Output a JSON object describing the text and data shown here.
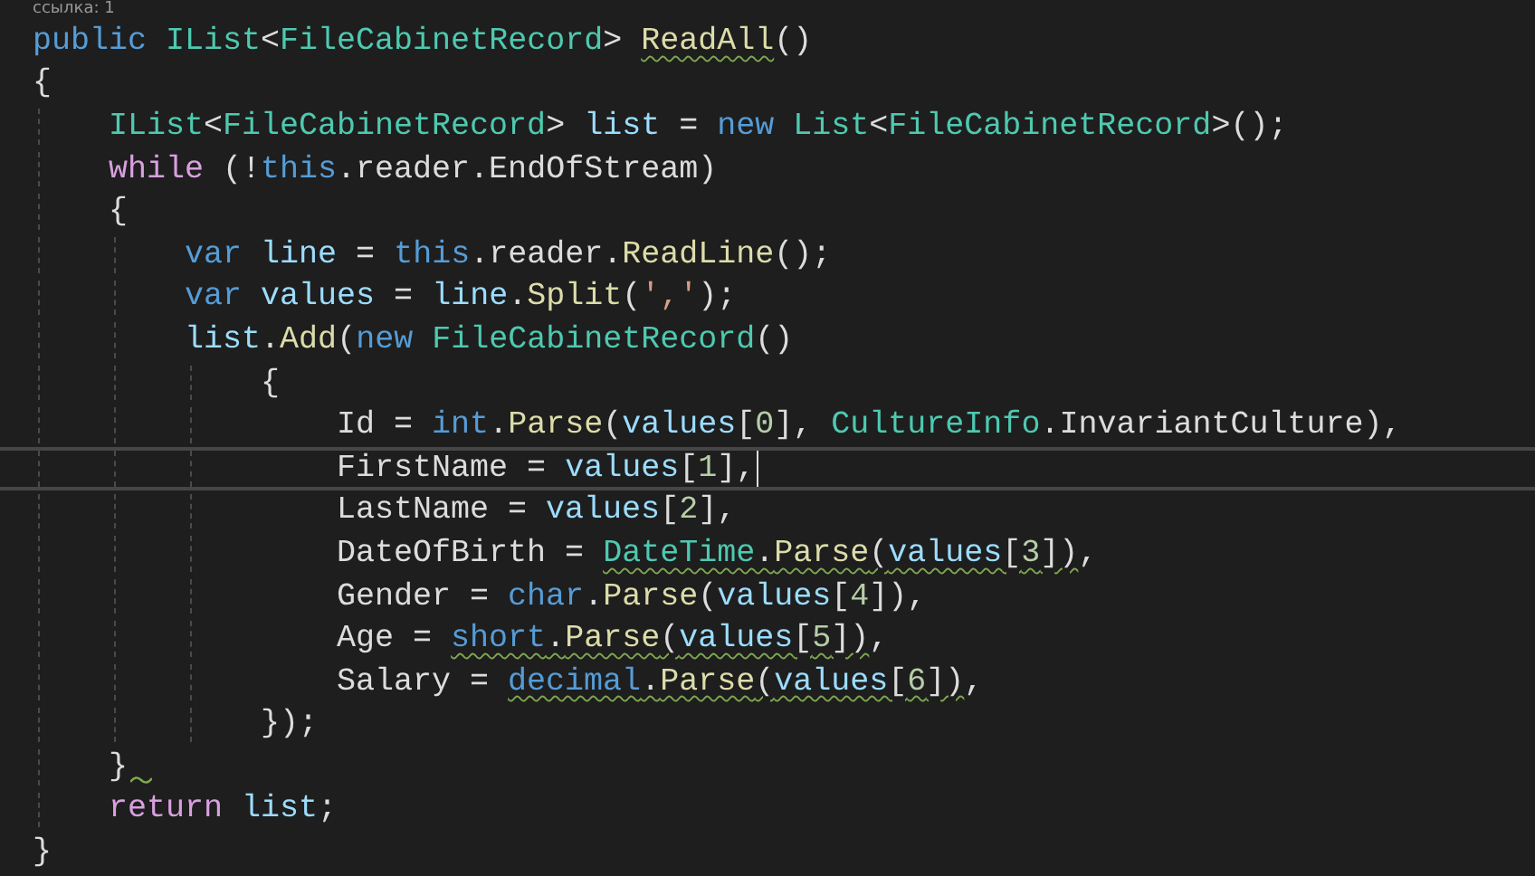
{
  "codelens": "ссылка: 1",
  "lines": [
    {
      "current": false,
      "tokens": [
        {
          "kind": "keyword",
          "text": "public "
        },
        {
          "kind": "type",
          "text": "IList"
        },
        {
          "kind": "plain",
          "text": "<"
        },
        {
          "kind": "type",
          "text": "FileCabinetRecord"
        },
        {
          "kind": "plain",
          "text": "> "
        },
        {
          "kind": "method",
          "text": "ReadAll",
          "squiggle": true
        },
        {
          "kind": "plain",
          "text": "()"
        }
      ]
    },
    {
      "current": false,
      "tokens": [
        {
          "kind": "plain",
          "text": "{"
        }
      ]
    },
    {
      "current": false,
      "tokens": [
        {
          "kind": "type",
          "text": "    IList"
        },
        {
          "kind": "plain",
          "text": "<"
        },
        {
          "kind": "type",
          "text": "FileCabinetRecord"
        },
        {
          "kind": "plain",
          "text": "> "
        },
        {
          "kind": "variable",
          "text": "list"
        },
        {
          "kind": "plain",
          "text": " = "
        },
        {
          "kind": "keyword",
          "text": "new "
        },
        {
          "kind": "type",
          "text": "List"
        },
        {
          "kind": "plain",
          "text": "<"
        },
        {
          "kind": "type",
          "text": "FileCabinetRecord"
        },
        {
          "kind": "plain",
          "text": ">();"
        }
      ]
    },
    {
      "current": false,
      "tokens": [
        {
          "kind": "control",
          "text": "    while"
        },
        {
          "kind": "plain",
          "text": " (!"
        },
        {
          "kind": "keyword",
          "text": "this"
        },
        {
          "kind": "plain",
          "text": ".reader.EndOfStream)"
        }
      ]
    },
    {
      "current": false,
      "tokens": [
        {
          "kind": "plain",
          "text": "    {"
        }
      ]
    },
    {
      "current": false,
      "tokens": [
        {
          "kind": "keyword",
          "text": "        var "
        },
        {
          "kind": "variable",
          "text": "line"
        },
        {
          "kind": "plain",
          "text": " = "
        },
        {
          "kind": "keyword",
          "text": "this"
        },
        {
          "kind": "plain",
          "text": ".reader."
        },
        {
          "kind": "method",
          "text": "ReadLine"
        },
        {
          "kind": "plain",
          "text": "();"
        }
      ]
    },
    {
      "current": false,
      "tokens": [
        {
          "kind": "keyword",
          "text": "        var "
        },
        {
          "kind": "variable",
          "text": "values"
        },
        {
          "kind": "plain",
          "text": " = "
        },
        {
          "kind": "variable",
          "text": "line"
        },
        {
          "kind": "plain",
          "text": "."
        },
        {
          "kind": "method",
          "text": "Split"
        },
        {
          "kind": "plain",
          "text": "("
        },
        {
          "kind": "string",
          "text": "','"
        },
        {
          "kind": "plain",
          "text": ");"
        }
      ]
    },
    {
      "current": false,
      "tokens": [
        {
          "kind": "variable",
          "text": "        list"
        },
        {
          "kind": "plain",
          "text": "."
        },
        {
          "kind": "method",
          "text": "Add"
        },
        {
          "kind": "plain",
          "text": "("
        },
        {
          "kind": "keyword",
          "text": "new "
        },
        {
          "kind": "type",
          "text": "FileCabinetRecord"
        },
        {
          "kind": "plain",
          "text": "()"
        }
      ]
    },
    {
      "current": false,
      "tokens": [
        {
          "kind": "plain",
          "text": "            {"
        }
      ]
    },
    {
      "current": false,
      "tokens": [
        {
          "kind": "plain",
          "text": "                Id = "
        },
        {
          "kind": "keyword",
          "text": "int"
        },
        {
          "kind": "plain",
          "text": "."
        },
        {
          "kind": "method",
          "text": "Parse"
        },
        {
          "kind": "plain",
          "text": "("
        },
        {
          "kind": "variable",
          "text": "values"
        },
        {
          "kind": "plain",
          "text": "["
        },
        {
          "kind": "number",
          "text": "0"
        },
        {
          "kind": "plain",
          "text": "], "
        },
        {
          "kind": "type",
          "text": "CultureInfo"
        },
        {
          "kind": "plain",
          "text": ".InvariantCulture),"
        }
      ]
    },
    {
      "current": true,
      "tokens": [
        {
          "kind": "plain",
          "text": "                FirstName = "
        },
        {
          "kind": "variable",
          "text": "values"
        },
        {
          "kind": "plain",
          "text": "["
        },
        {
          "kind": "number",
          "text": "1"
        },
        {
          "kind": "plain",
          "text": "],"
        }
      ]
    },
    {
      "current": false,
      "tokens": [
        {
          "kind": "plain",
          "text": "                LastName = "
        },
        {
          "kind": "variable",
          "text": "values"
        },
        {
          "kind": "plain",
          "text": "["
        },
        {
          "kind": "number",
          "text": "2"
        },
        {
          "kind": "plain",
          "text": "],"
        }
      ]
    },
    {
      "current": false,
      "tokens": [
        {
          "kind": "plain",
          "text": "                DateOfBirth = "
        },
        {
          "kind": "type",
          "text": "DateTime",
          "squiggle": true
        },
        {
          "kind": "plain",
          "text": ".",
          "squiggle": true
        },
        {
          "kind": "method",
          "text": "Parse",
          "squiggle": true
        },
        {
          "kind": "plain",
          "text": "(",
          "squiggle": true
        },
        {
          "kind": "variable",
          "text": "values",
          "squiggle": true
        },
        {
          "kind": "plain",
          "text": "[",
          "squiggle": true
        },
        {
          "kind": "number",
          "text": "3",
          "squiggle": true
        },
        {
          "kind": "plain",
          "text": "])",
          "squiggle": true
        },
        {
          "kind": "plain",
          "text": ","
        }
      ]
    },
    {
      "current": false,
      "tokens": [
        {
          "kind": "plain",
          "text": "                Gender = "
        },
        {
          "kind": "keyword",
          "text": "char"
        },
        {
          "kind": "plain",
          "text": "."
        },
        {
          "kind": "method",
          "text": "Parse"
        },
        {
          "kind": "plain",
          "text": "("
        },
        {
          "kind": "variable",
          "text": "values"
        },
        {
          "kind": "plain",
          "text": "["
        },
        {
          "kind": "number",
          "text": "4"
        },
        {
          "kind": "plain",
          "text": "]),"
        }
      ]
    },
    {
      "current": false,
      "tokens": [
        {
          "kind": "plain",
          "text": "                Age = "
        },
        {
          "kind": "keyword",
          "text": "short",
          "squiggle": true
        },
        {
          "kind": "plain",
          "text": ".",
          "squiggle": true
        },
        {
          "kind": "method",
          "text": "Parse",
          "squiggle": true
        },
        {
          "kind": "plain",
          "text": "(",
          "squiggle": true
        },
        {
          "kind": "variable",
          "text": "values",
          "squiggle": true
        },
        {
          "kind": "plain",
          "text": "[",
          "squiggle": true
        },
        {
          "kind": "number",
          "text": "5",
          "squiggle": true
        },
        {
          "kind": "plain",
          "text": "])",
          "squiggle": true
        },
        {
          "kind": "plain",
          "text": ","
        }
      ]
    },
    {
      "current": false,
      "tokens": [
        {
          "kind": "plain",
          "text": "                Salary = "
        },
        {
          "kind": "keyword",
          "text": "decimal",
          "squiggle": true
        },
        {
          "kind": "plain",
          "text": ".",
          "squiggle": true
        },
        {
          "kind": "method",
          "text": "Parse",
          "squiggle": true
        },
        {
          "kind": "plain",
          "text": "(",
          "squiggle": true
        },
        {
          "kind": "variable",
          "text": "values",
          "squiggle": true
        },
        {
          "kind": "plain",
          "text": "[",
          "squiggle": true
        },
        {
          "kind": "number",
          "text": "6",
          "squiggle": true
        },
        {
          "kind": "plain",
          "text": "])",
          "squiggle": true
        },
        {
          "kind": "plain",
          "text": ","
        }
      ]
    },
    {
      "current": false,
      "tokens": [
        {
          "kind": "plain",
          "text": "            });"
        }
      ]
    },
    {
      "current": false,
      "trailing_squiggle": true,
      "tokens": [
        {
          "kind": "plain",
          "text": "    }"
        }
      ]
    },
    {
      "current": false,
      "tokens": [
        {
          "kind": "control",
          "text": "    return "
        },
        {
          "kind": "variable",
          "text": "list"
        },
        {
          "kind": "plain",
          "text": ";"
        }
      ]
    },
    {
      "current": false,
      "tokens": [
        {
          "kind": "plain",
          "text": "}"
        }
      ]
    }
  ]
}
